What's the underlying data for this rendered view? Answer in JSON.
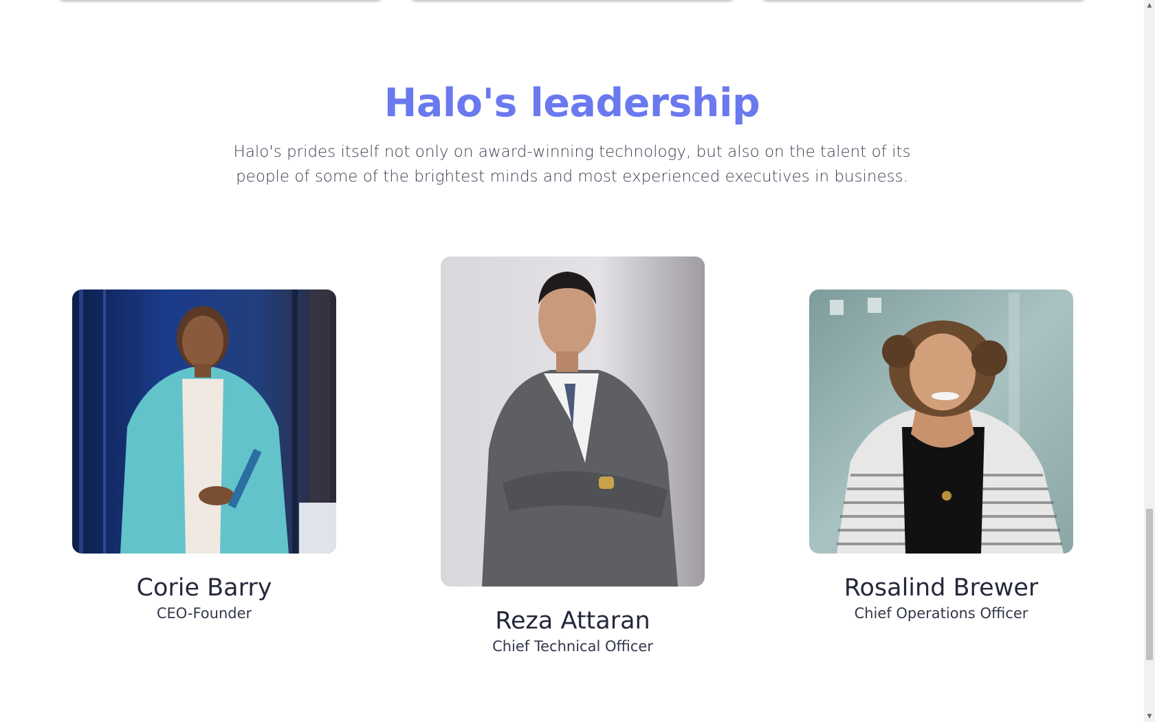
{
  "leadership": {
    "title": "Halo's leadership",
    "description": "Halo's prides itself not only on award-winning technology, but also on the talent of its people of some of the brightest minds and most experienced executives in business."
  },
  "leaders": [
    {
      "name": "Corie Barry",
      "role": "CEO-Founder"
    },
    {
      "name": "Reza Attaran",
      "role": "Chief Technical Officer"
    },
    {
      "name": "Rosalind Brewer",
      "role": "Chief Operations Officer"
    }
  ],
  "colors": {
    "accent": "#6a79ee",
    "text": "#25283a"
  },
  "scrollbar": {
    "up_arrow": "▲",
    "down_arrow": "▼"
  }
}
